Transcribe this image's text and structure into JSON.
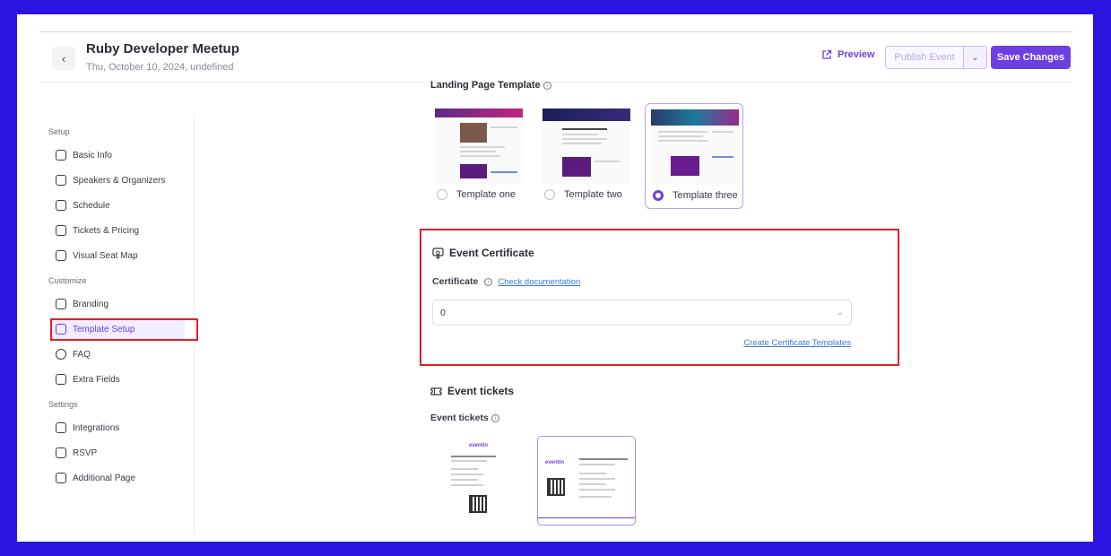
{
  "header": {
    "back_icon": "chevron-left-icon",
    "title": "Ruby Developer Meetup",
    "date": "Thu, October 10, 2024, undefined",
    "preview_label": "Preview",
    "publish_label": "Publish Event",
    "save_label": "Save Changes",
    "accent_color": "#6d3fe0"
  },
  "sidebar": {
    "sections": [
      {
        "label": "Setup"
      },
      {
        "label": "Customize"
      },
      {
        "label": "Settings"
      }
    ],
    "items": [
      {
        "label": "Basic Info",
        "icon": "basic-info-icon"
      },
      {
        "label": "Speakers & Organizers",
        "icon": "speakers-icon"
      },
      {
        "label": "Schedule",
        "icon": "schedule-icon"
      },
      {
        "label": "Tickets & Pricing",
        "icon": "ticket-icon"
      },
      {
        "label": "Visual Seat Map",
        "icon": "seat-map-icon"
      },
      {
        "label": "Branding",
        "icon": "branding-icon"
      },
      {
        "label": "Template Setup",
        "icon": "template-icon",
        "active": true
      },
      {
        "label": "FAQ",
        "icon": "faq-icon"
      },
      {
        "label": "Extra Fields",
        "icon": "extra-fields-icon"
      },
      {
        "label": "Integrations",
        "icon": "integrations-icon"
      },
      {
        "label": "RSVP",
        "icon": "rsvp-icon"
      },
      {
        "label": "Additional Page",
        "icon": "additional-page-icon"
      }
    ]
  },
  "landing": {
    "title": "Landing Page Template",
    "templates": [
      {
        "label": "Template one",
        "selected": false
      },
      {
        "label": "Template two",
        "selected": false
      },
      {
        "label": "Template three",
        "selected": true
      }
    ]
  },
  "certificate": {
    "title": "Event Certificate",
    "label": "Certificate",
    "doc_link": "Check documentation",
    "selected_value": "0",
    "create_link": "Create Certificate Templates"
  },
  "tickets": {
    "title": "Event tickets",
    "label": "Event tickets",
    "logo_text": "eventin"
  }
}
